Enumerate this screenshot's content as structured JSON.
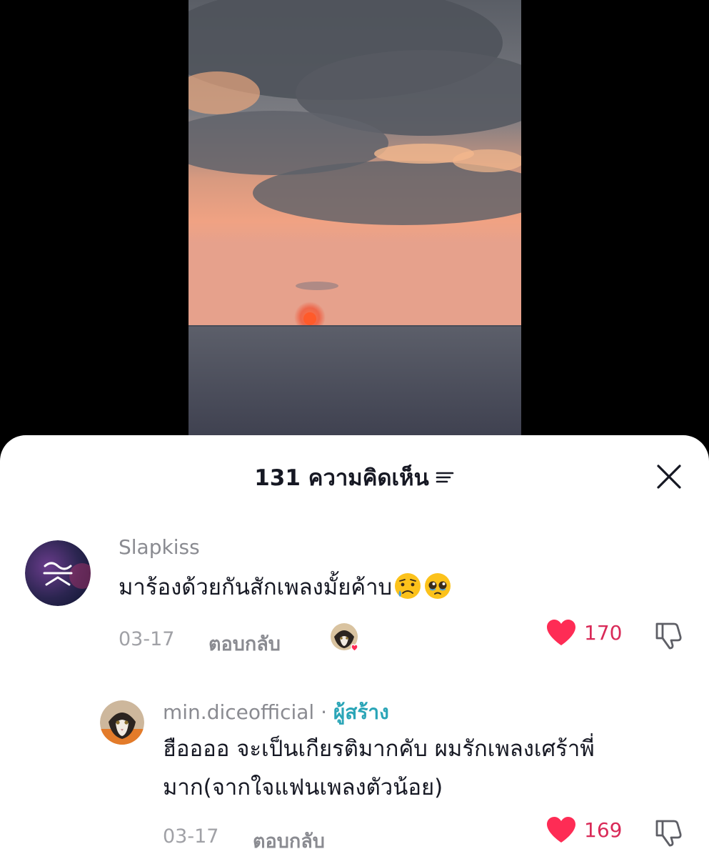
{
  "header": {
    "title": "131 ความคิดเห็น"
  },
  "comments": [
    {
      "username": "Slapkiss",
      "text": "มาร้องด้วยกันสักเพลงมั้ยค้าบ",
      "emojis": [
        "sad-sweat-face",
        "pleading-face"
      ],
      "date": "03-17",
      "reply_label": "ตอบกลับ",
      "likes": "170",
      "liked_by_creator": true
    },
    {
      "username": "min.diceofficial",
      "separator": " · ",
      "creator_label": "ผู้สร้าง",
      "text_line1": "ฮืออออ จะเป็นเกียรติมากคับ ผมรักเพลงเศร้าพี่",
      "text_line2": "มาก(จากใจแฟนเพลงตัวน้อย)",
      "date": "03-17",
      "reply_label": "ตอบกลับ",
      "likes": "169"
    }
  ],
  "colors": {
    "like": "#d92a58",
    "creator": "#2aa5b7",
    "text": "#161823",
    "muted": "#8a8b91"
  }
}
